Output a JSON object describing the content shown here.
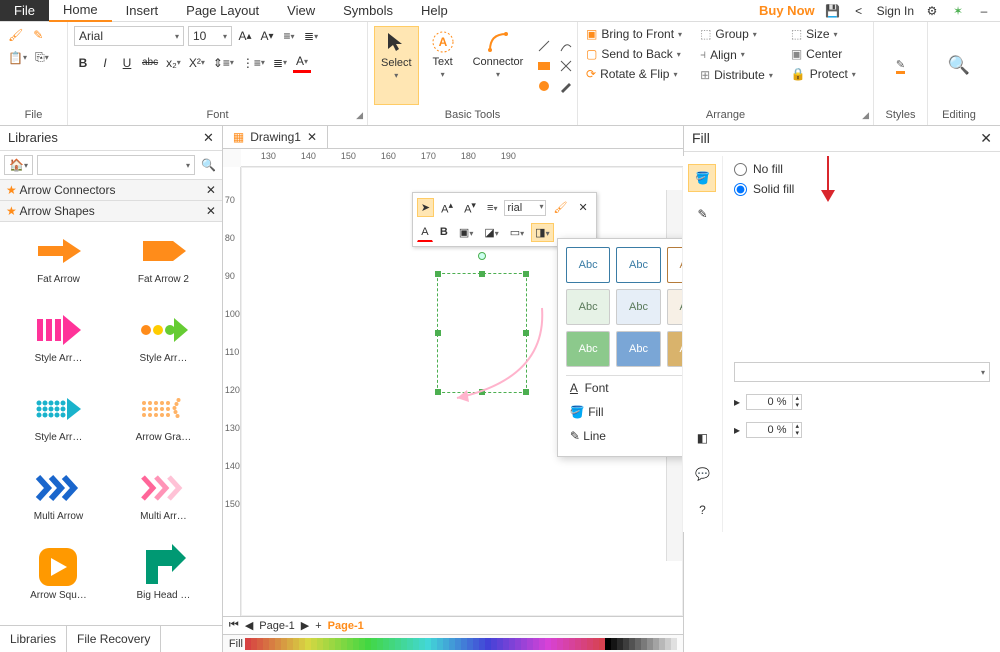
{
  "menu": {
    "file": "File",
    "items": [
      "Home",
      "Insert",
      "Page Layout",
      "View",
      "Symbols",
      "Help"
    ],
    "active": "Home",
    "buynow": "Buy Now",
    "signin": "Sign In"
  },
  "ribbon": {
    "file_label": "File",
    "font_label": "Font",
    "tools_label": "Basic Tools",
    "arrange_label": "Arrange",
    "styles_label": "Styles",
    "editing_label": "Editing",
    "font_name": "Arial",
    "font_size": "10",
    "bold": "B",
    "italic": "I",
    "underline": "U",
    "strike": "abc",
    "select": "Select",
    "text": "Text",
    "connector": "Connector",
    "bring_front": "Bring to Front",
    "send_back": "Send to Back",
    "rotate_flip": "Rotate & Flip",
    "group": "Group",
    "align": "Align",
    "distribute": "Distribute",
    "size": "Size",
    "center": "Center",
    "protect": "Protect"
  },
  "libraries": {
    "title": "Libraries",
    "sections": [
      "Arrow Connectors",
      "Arrow Shapes"
    ],
    "shapes": [
      {
        "name": "Fat Arrow",
        "color": "#ff8c1a"
      },
      {
        "name": "Fat Arrow 2",
        "color": "#ff8c1a"
      },
      {
        "name": "Style Arr…",
        "color": "#ff3399"
      },
      {
        "name": "Style Arr…",
        "color": "#ff9933"
      },
      {
        "name": "Style Arr…",
        "color": "#1ab3cc"
      },
      {
        "name": "Arrow Gra…",
        "color": "#ffb366"
      },
      {
        "name": "Multi Arrow",
        "color": "#1a66cc"
      },
      {
        "name": "Multi Arr…",
        "color": "#ff6699"
      },
      {
        "name": "Arrow Squ…",
        "color": "#ff9900"
      },
      {
        "name": "Big Head …",
        "color": "#009973"
      }
    ],
    "tabs": [
      "Libraries",
      "File Recovery"
    ]
  },
  "doc": {
    "name": "Drawing1"
  },
  "ruler_h": [
    "130",
    "140",
    "150",
    "160",
    "170",
    "180",
    "190"
  ],
  "ruler_v": [
    "70",
    "80",
    "90",
    "100",
    "110",
    "120",
    "130",
    "140",
    "150"
  ],
  "mini_toolbar": {
    "font": "rial"
  },
  "style_popup": {
    "abc": "Abc",
    "menu": [
      "Font",
      "Fill",
      "Line"
    ]
  },
  "fill_panel": {
    "title": "Fill",
    "no_fill": "No fill",
    "solid_fill": "Solid fill",
    "pct1": "0 %",
    "pct2": "0 %"
  },
  "pages": {
    "p1": "Page-1",
    "p2": "Page-1"
  },
  "fillbar_label": "Fill"
}
